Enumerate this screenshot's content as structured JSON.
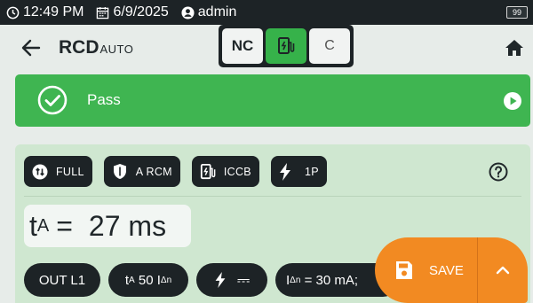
{
  "status": {
    "time": "12:49 PM",
    "date": "6/9/2025",
    "user": "admin",
    "battery": "99"
  },
  "header": {
    "title": "RCD",
    "title_sub": "AUTO",
    "modes": [
      "NC",
      "C"
    ],
    "active_mode": "ev-charger"
  },
  "result": {
    "status": "Pass",
    "color": "#3fb551"
  },
  "config_chips": [
    {
      "icon": "full-icon",
      "label": "FULL"
    },
    {
      "icon": "shield-icon",
      "label": "A RCM"
    },
    {
      "icon": "ev-charger-icon",
      "label": "ICCB"
    },
    {
      "icon": "lightning-icon",
      "label": "1P"
    }
  ],
  "measurement": {
    "symbol": "t",
    "subscript": "A",
    "eq": "=",
    "value": "27 ms"
  },
  "params": {
    "out": "OUT L1",
    "trip_prefix": "t",
    "trip_sub": "A",
    "trip_value": "50 I",
    "trip_value_sub": "Δn",
    "dc_symbol": "⎓",
    "i_prefix": "I",
    "i_sub": "Δn",
    "i_value": "= 30 mA;"
  },
  "fab": {
    "save_label": "SAVE",
    "accent": "#f28a22"
  }
}
